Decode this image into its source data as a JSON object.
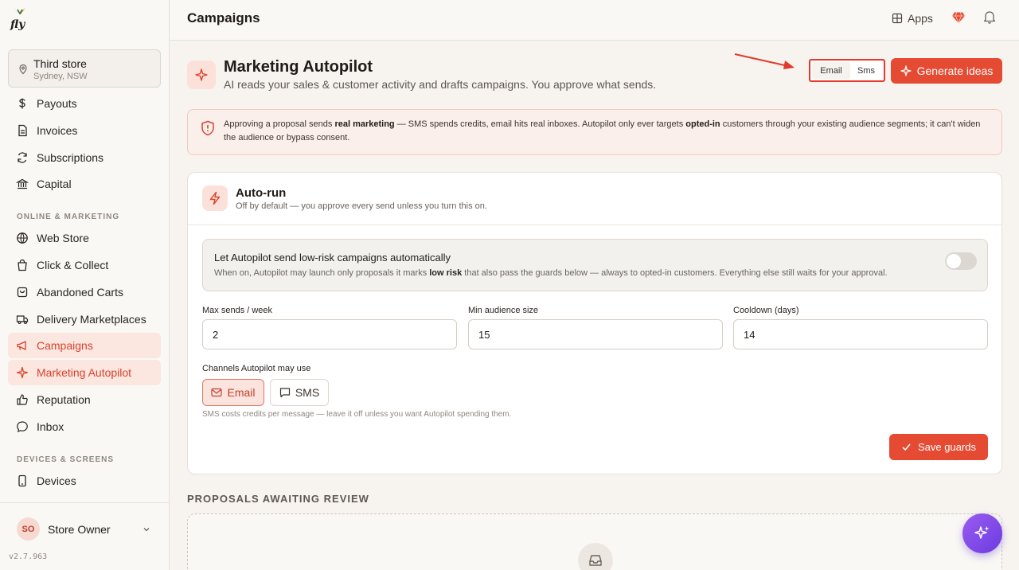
{
  "topbar": {
    "title": "Campaigns",
    "apps_label": "Apps"
  },
  "store": {
    "name": "Third store",
    "location": "Sydney, NSW"
  },
  "sidebar": {
    "items_top": [
      {
        "label": "Payouts"
      },
      {
        "label": "Invoices"
      },
      {
        "label": "Subscriptions"
      },
      {
        "label": "Capital"
      }
    ],
    "section_online": "ONLINE & MARKETING",
    "items_online": [
      {
        "label": "Web Store"
      },
      {
        "label": "Click & Collect"
      },
      {
        "label": "Abandoned Carts"
      },
      {
        "label": "Delivery Marketplaces"
      },
      {
        "label": "Campaigns"
      },
      {
        "label": "Marketing Autopilot"
      },
      {
        "label": "Reputation"
      },
      {
        "label": "Inbox"
      }
    ],
    "section_devices": "DEVICES & SCREENS",
    "items_devices": [
      {
        "label": "Devices"
      }
    ],
    "active_items": [
      "Campaigns",
      "Marketing Autopilot"
    ],
    "user": {
      "initials": "SO",
      "name": "Store Owner"
    },
    "version": "v2.7.963"
  },
  "header": {
    "title": "Marketing Autopilot",
    "subtitle": "AI reads your sales & customer activity and drafts campaigns. You approve what sends.",
    "channel_options": [
      "Email",
      "Sms"
    ],
    "channel_selected": "Email",
    "generate_label": "Generate ideas"
  },
  "warning": {
    "part1": "Approving a proposal sends ",
    "bold1": "real marketing",
    "part2": " — SMS spends credits, email hits real inboxes. Autopilot only ever targets ",
    "bold2": "opted-in",
    "part3": " customers through your existing audience segments; it can't widen the audience or bypass consent."
  },
  "autorun": {
    "title": "Auto-run",
    "subtitle": "Off by default — you approve every send unless you turn this on.",
    "toggle_title": "Let Autopilot send low-risk campaigns automatically",
    "toggle_sub1": "When on, Autopilot may launch only proposals it marks ",
    "toggle_sub_bold": "low risk",
    "toggle_sub2": " that also pass the guards below — always to opted-in customers. Everything else still waits for your approval.",
    "toggle_on": false,
    "fields": [
      {
        "label": "Max sends / week",
        "value": "2"
      },
      {
        "label": "Min audience size",
        "value": "15"
      },
      {
        "label": "Cooldown (days)",
        "value": "14"
      }
    ],
    "channels_label": "Channels Autopilot may use",
    "channel_email": "Email",
    "channel_sms": "SMS",
    "channel_note": "SMS costs credits per message — leave it off unless you want Autopilot spending them.",
    "save_label": "Save guards"
  },
  "proposals": {
    "label": "PROPOSALS AWAITING REVIEW"
  },
  "colors": {
    "accent": "#e54a33",
    "active_bg": "#fbe6e0",
    "fab_gradient_start": "#9a5cf0",
    "fab_gradient_end": "#6b3ce0"
  }
}
